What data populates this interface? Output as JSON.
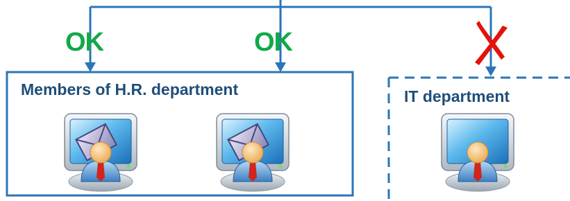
{
  "colors": {
    "connector": "#2a74b9",
    "ok": "#12a84a",
    "deny": "#e3120b",
    "group_title": "#1f4e79",
    "group_border": "#2a74b9"
  },
  "status": {
    "ok_label": "OK",
    "deny_icon": "red-cross-icon"
  },
  "groups": [
    {
      "title": "Members of H.R. department",
      "border": "solid",
      "computers": [
        {
          "icon": "computer-user-with-envelope-icon",
          "has_envelope": true
        },
        {
          "icon": "computer-user-with-envelope-icon",
          "has_envelope": true
        }
      ]
    },
    {
      "title": "IT department",
      "border": "dashed",
      "computers": [
        {
          "icon": "computer-user-icon",
          "has_envelope": false
        }
      ]
    }
  ]
}
